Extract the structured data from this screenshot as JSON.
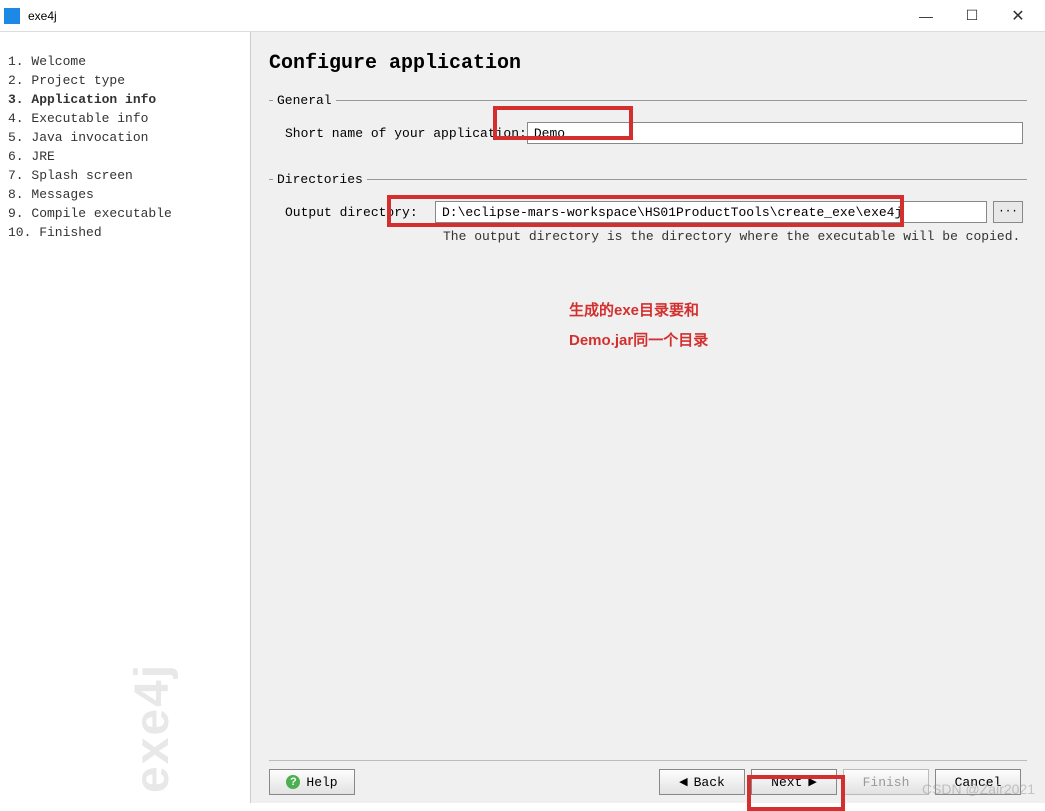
{
  "window": {
    "title": "exe4j"
  },
  "steps": [
    "1. Welcome",
    "2. Project type",
    "3. Application info",
    "4. Executable info",
    "5. Java invocation",
    "6. JRE",
    "7. Splash screen",
    "8. Messages",
    "9. Compile executable",
    "10. Finished"
  ],
  "active_step_index": 2,
  "watermark": "exe4j",
  "page": {
    "title": "Configure application",
    "general": {
      "legend": "General",
      "short_name_label": "Short name of your application:",
      "short_name_value": "Demo"
    },
    "directories": {
      "legend": "Directories",
      "output_label": "Output directory:",
      "output_value": "D:\\eclipse-mars-workspace\\HS01ProductTools\\create_exe\\exe4j",
      "browse_label": "···",
      "hint": "The output directory is the directory where the executable will be copied."
    },
    "annotation_line1": "生成的exe目录要和",
    "annotation_line2": "Demo.jar同一个目录"
  },
  "buttons": {
    "help": "Help",
    "back": "Back",
    "next": "Next",
    "finish": "Finish",
    "cancel": "Cancel"
  },
  "csdn_watermark": "CSDN @Zair2021"
}
